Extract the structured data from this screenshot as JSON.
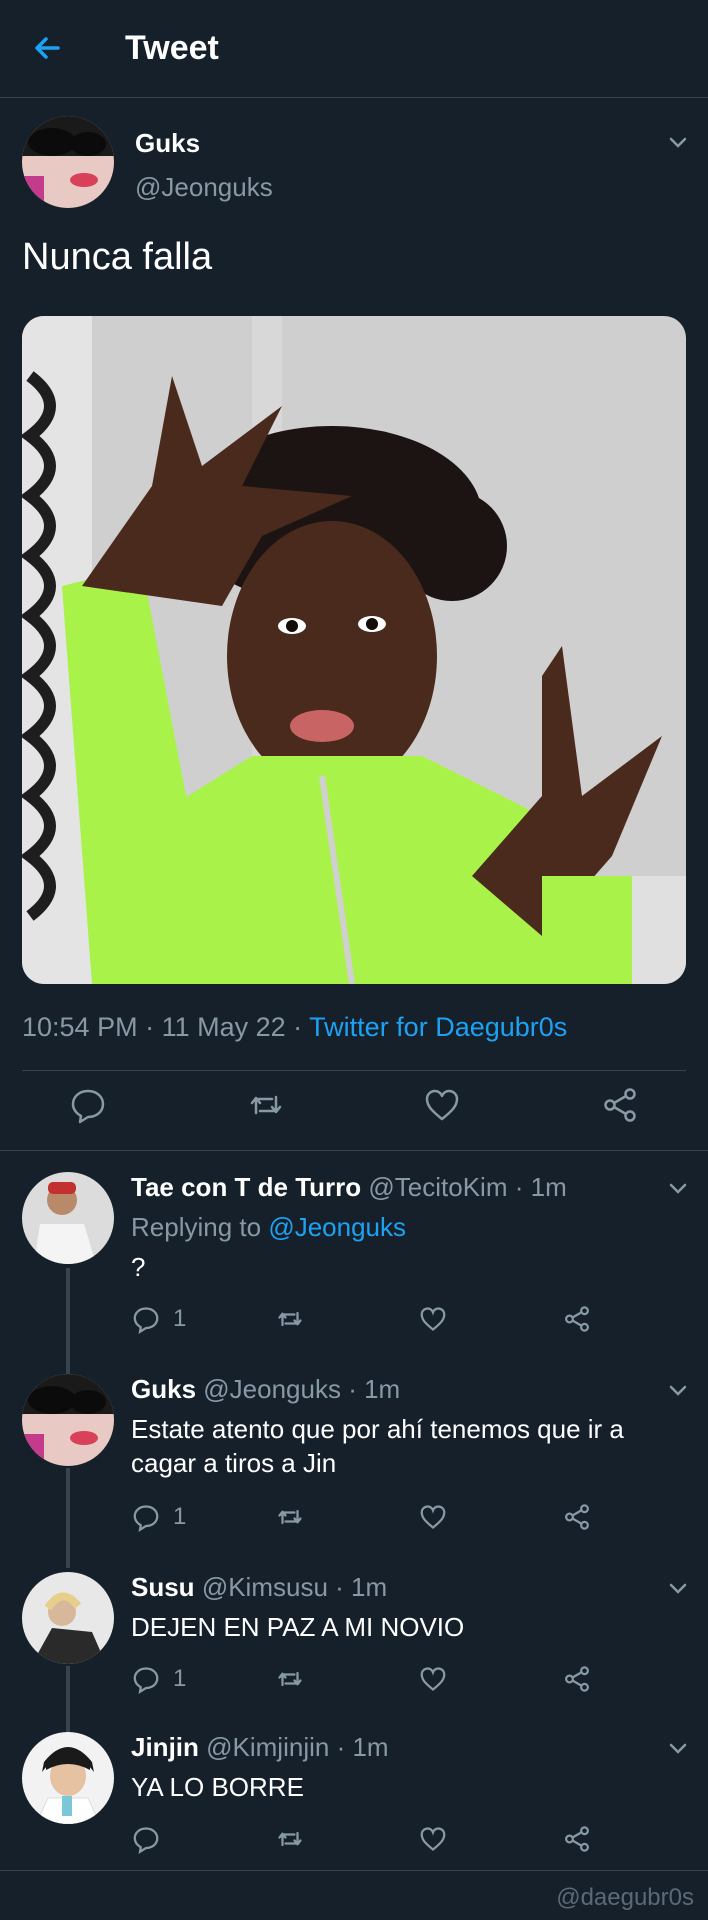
{
  "header": {
    "title": "Tweet",
    "back_icon": "arrow-left-icon"
  },
  "tweet": {
    "author_name": "Guks",
    "author_handle": "@Jeonguks",
    "text": "Nunca falla",
    "time": "10:54 PM",
    "date": "11 May 22",
    "source": "Twitter for Daegubr0s",
    "meta_sep1": " · ",
    "meta_sep2": " · "
  },
  "replies": [
    {
      "name": "Tae con T de Turro",
      "handle": "@TecitoKim",
      "time": "1m",
      "replying_label": "Replying to",
      "replying_to": "@Jeonguks",
      "text": "?",
      "reply_count": "1"
    },
    {
      "name": "Guks",
      "handle": "@Jeonguks",
      "time": "1m",
      "text": "Estate atento que por ahí tenemos que ir a cagar a tiros a Jin",
      "reply_count": "1"
    },
    {
      "name": "Susu",
      "handle": "@Kimsusu",
      "time": "1m",
      "text": "DEJEN EN PAZ A MI NOVIO",
      "reply_count": "1"
    },
    {
      "name": "Jinjin",
      "handle": "@Kimjinjin",
      "time": "1m",
      "text": "YA LO BORRE",
      "reply_count": ""
    }
  ],
  "dot": " · ",
  "watermark": "@daegubr0s",
  "colors": {
    "background": "#15202b",
    "accent": "#1da1f2",
    "muted": "#8899a6",
    "divider": "#38444d"
  }
}
